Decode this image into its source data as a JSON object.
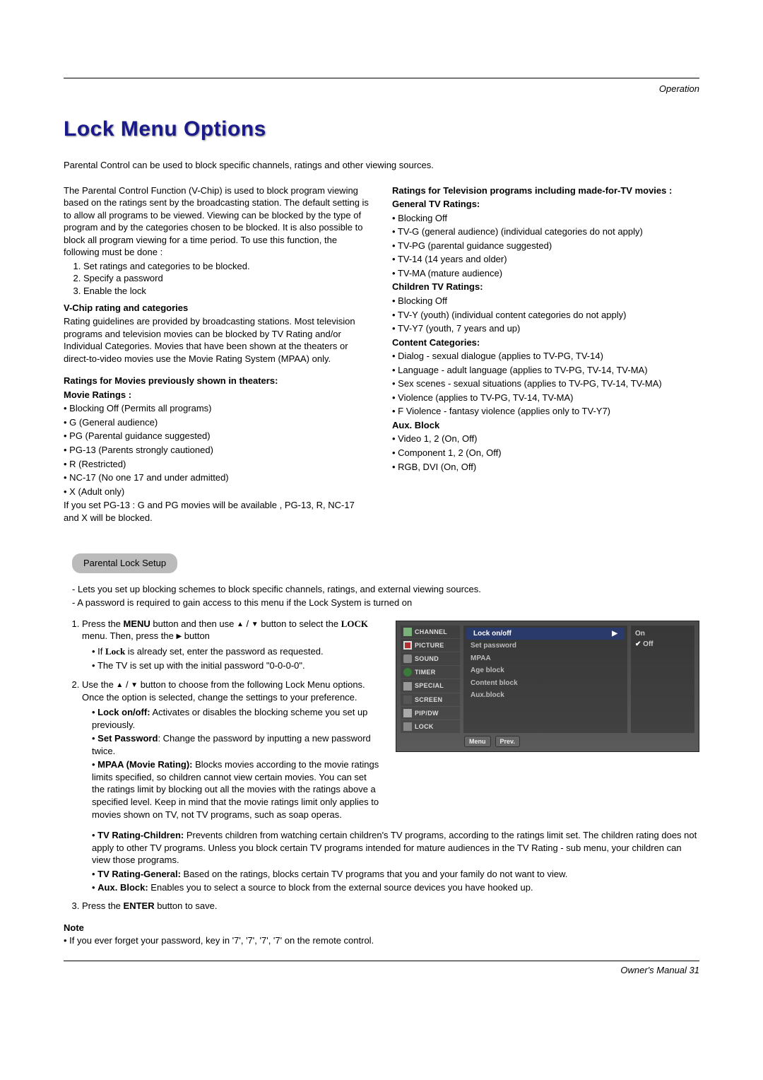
{
  "header": {
    "section_label": "Operation"
  },
  "title": "Lock Menu Options",
  "intro": "Parental Control can be used to block specific channels, ratings and other viewing sources.",
  "left": {
    "p1": "The Parental Control Function (V-Chip) is used to block program viewing based on the ratings sent by the broadcasting station. The default setting is to allow all programs to be viewed. Viewing can be blocked by the type of program and by the categories chosen to be blocked. It is also possible to block all program viewing for a time period. To use this function, the following must be done :",
    "steps": [
      "Set ratings and categories to be blocked.",
      "Specify a password",
      "Enable the lock"
    ],
    "h_vchip": "V-Chip rating and categories",
    "p_vchip": "Rating guidelines are provided by broadcasting stations. Most television programs and television movies can be blocked by TV Rating and/or Individual Categories. Movies that have been shown at the theaters or direct-to-video movies use the Movie Rating System (MPAA) only.",
    "h_movies": "Ratings for Movies previously shown in theaters:",
    "h_movie_ratings": "Movie Ratings :",
    "movie_items": [
      "• Blocking Off (Permits all programs)",
      "• G (General audience)",
      "• PG (Parental guidance suggested)",
      "• PG-13 (Parents strongly cautioned)",
      "• R (Restricted)",
      "• NC-17 (No one 17 and under admitted)",
      "• X (Adult only)"
    ],
    "movie_note": "If you set PG-13 : G and PG movies will be available , PG-13, R, NC-17 and X will be blocked."
  },
  "right": {
    "h_tv": "Ratings for Television programs including made-for-TV movies :",
    "h_gen": "General TV Ratings:",
    "gen_items": [
      "• Blocking Off",
      "• TV-G (general audience) (individual categories do not apply)",
      "• TV-PG (parental guidance suggested)",
      "• TV-14 (14 years and older)",
      "• TV-MA (mature audience)"
    ],
    "h_child": "Children TV Ratings:",
    "child_items": [
      "• Blocking Off",
      "• TV-Y (youth) (individual content categories do not apply)",
      "• TV-Y7 (youth, 7 years and up)"
    ],
    "h_content": "Content Categories:",
    "content_items": [
      "• Dialog - sexual dialogue (applies to TV-PG, TV-14)",
      "• Language - adult language (applies to TV-PG, TV-14, TV-MA)",
      "• Sex scenes - sexual situations (applies to TV-PG, TV-14, TV-MA)",
      "• Violence (applies to TV-PG, TV-14, TV-MA)",
      "• F Violence - fantasy violence (applies only to TV-Y7)"
    ],
    "h_aux": "Aux. Block",
    "aux_items": [
      "• Video 1, 2 (On, Off)",
      "• Component 1, 2 (On, Off)",
      "• RGB, DVI (On, Off)"
    ]
  },
  "pill": "Parental Lock Setup",
  "setup": {
    "dash1": "Lets you set up blocking schemes to block specific channels, ratings, and external viewing sources.",
    "dash2": "A password is required to gain access to this menu if the Lock System is turned on",
    "step1_a": "Press the ",
    "step1_menu": "MENU",
    "step1_b": " button and then use ",
    "step1_c": " button to select the ",
    "step1_lock": "LOCK",
    "step1_d": " menu. Then, press the ",
    "step1_e": " button",
    "s1b1_a": "If ",
    "s1b1_lock": "Lock",
    "s1b1_b": " is already set, enter the password as requested.",
    "s1b2": "The TV is set up with the initial password \"0-0-0-0\".",
    "step2_a": "Use the ",
    "step2_b": " button to choose from the following Lock Menu options. Once the option is selected, change the settings to your preference.",
    "opt1_l": "Lock on/off:",
    "opt1_t": " Activates or disables the blocking scheme you set up previously.",
    "opt2_l": "Set Password",
    "opt2_t": ": Change the password by inputting a new password twice.",
    "opt3_l": "MPAA (Movie Rating):",
    "opt3_t": " Blocks movies according to the movie ratings limits specified, so children cannot view certain movies. You can set the ratings limit by blocking out all the movies with the ratings above a specified level. Keep in mind that the movie ratings limit only applies to movies shown on TV, not TV programs, such as soap operas.",
    "opt4_l": "TV Rating-Children:",
    "opt4_t": " Prevents children from watching certain children's TV programs, according to the ratings limit set. The children rating does not apply to other TV programs. Unless you block certain TV programs intended for mature audiences in the TV Rating - sub menu, your children can view those programs.",
    "opt5_l": "TV Rating-General:",
    "opt5_t": " Based on the ratings, blocks certain TV programs that you and your family do not want to view.",
    "opt6_l": "Aux. Block:",
    "opt6_t": " Enables you to select a source to block from the external source devices you have hooked up.",
    "step3_a": "Press the ",
    "step3_enter": "ENTER",
    "step3_b": " button to save."
  },
  "note": {
    "h": "Note",
    "line": "• If you ever forget your password, key in '7', '7', '7', '7' on the remote control."
  },
  "osd": {
    "sidebar": [
      "CHANNEL",
      "PICTURE",
      "SOUND",
      "TIMER",
      "SPECIAL",
      "SCREEN",
      "PIP/DW",
      "LOCK"
    ],
    "menu": [
      "Lock on/off",
      "Set password",
      "MPAA",
      "Age block",
      "Content block",
      "Aux.block"
    ],
    "selected_menu": "Lock on/off",
    "options": [
      "On",
      "Off"
    ],
    "selected_option": "Off",
    "footer": [
      "Menu",
      "Prev."
    ]
  },
  "footer": {
    "text": "Owner's Manual  31"
  }
}
